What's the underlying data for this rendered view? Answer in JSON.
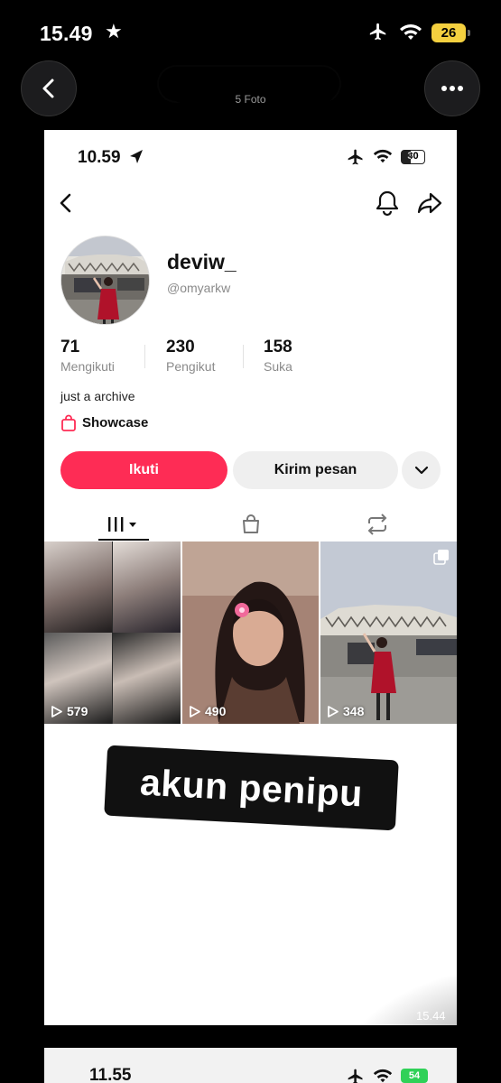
{
  "viewer": {
    "status": {
      "time": "15.49",
      "battery": "26"
    },
    "photo_count": "5 Foto"
  },
  "profile": {
    "status": {
      "time": "10.59",
      "battery": "30"
    },
    "username": "deviw_",
    "handle": "@omyarkw",
    "stats": [
      {
        "value": "71",
        "label": "Mengikuti"
      },
      {
        "value": "230",
        "label": "Pengikut"
      },
      {
        "value": "158",
        "label": "Suka"
      }
    ],
    "bio": "just a archive",
    "showcase_label": "Showcase",
    "follow_label": "Ikuti",
    "message_label": "Kirim pesan",
    "videos": [
      {
        "views": "579"
      },
      {
        "views": "490"
      },
      {
        "views": "348"
      }
    ],
    "accent_color": "#fe2c55"
  },
  "overlay": {
    "sticker_text": "akun penipu",
    "screenshot_time": "15.44"
  },
  "next_card": {
    "time": "11.55",
    "battery": "54"
  }
}
